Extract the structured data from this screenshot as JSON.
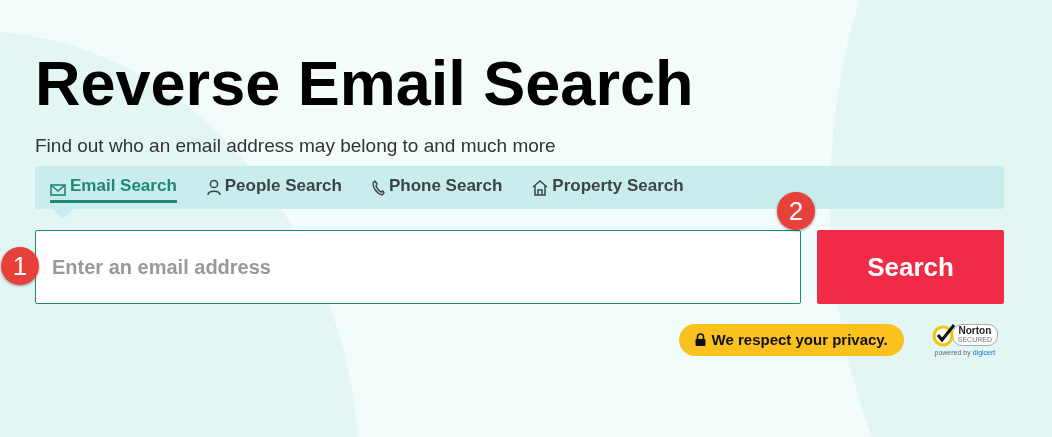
{
  "title": "Reverse Email Search",
  "subtitle": "Find out who an email address may belong to and much more",
  "tabs": [
    {
      "label": "Email Search",
      "kind": "email",
      "selected": true
    },
    {
      "label": "People Search",
      "kind": "person",
      "selected": false
    },
    {
      "label": "Phone Search",
      "kind": "phone",
      "selected": false
    },
    {
      "label": "Property Search",
      "kind": "house",
      "selected": false
    }
  ],
  "search": {
    "placeholder": "Enter an email address",
    "button": "Search"
  },
  "markers": [
    "1",
    "2"
  ],
  "privacy": "We respect your privacy.",
  "norton": {
    "name": "Norton",
    "secured": "SECURED",
    "powered": "powered by",
    "brand": "digicert"
  }
}
